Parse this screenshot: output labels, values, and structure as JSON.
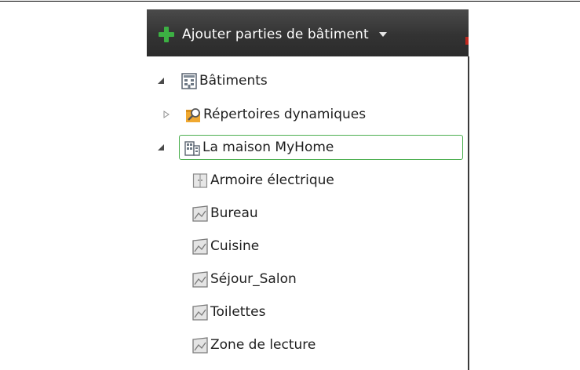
{
  "toolbar": {
    "add_label": "Ajouter parties de bâtiment"
  },
  "colors": {
    "toolbar_bg": "#333333",
    "add_icon": "#3cb043",
    "selection_border": "#4caf50"
  },
  "tree": {
    "root": {
      "label": "Bâtiments",
      "expanded": true,
      "icon": "buildings-icon"
    },
    "dynamic": {
      "label": "Répertoires dynamiques",
      "expanded": false,
      "icon": "dynamic-folder-icon"
    },
    "house": {
      "label": "La maison MyHome",
      "expanded": true,
      "selected": true,
      "icon": "building-icon"
    },
    "children": [
      {
        "label": "Armoire électrique",
        "icon": "cabinet-icon"
      },
      {
        "label": "Bureau",
        "icon": "room-icon"
      },
      {
        "label": "Cuisine",
        "icon": "room-icon"
      },
      {
        "label": "Séjour_Salon",
        "icon": "room-icon"
      },
      {
        "label": "Toilettes",
        "icon": "room-icon"
      },
      {
        "label": "Zone de lecture",
        "icon": "room-icon"
      }
    ]
  }
}
